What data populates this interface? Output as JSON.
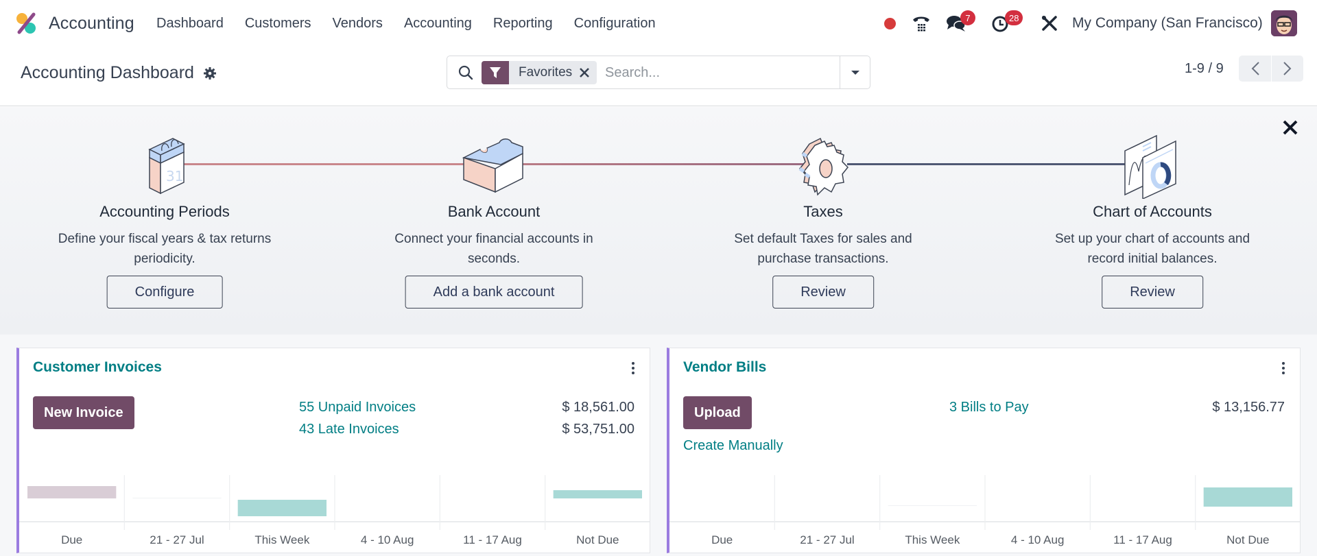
{
  "navbar": {
    "app_name": "Accounting",
    "menu": [
      "Dashboard",
      "Customers",
      "Vendors",
      "Accounting",
      "Reporting",
      "Configuration"
    ],
    "systray": {
      "messages_badge": "7",
      "activities_badge": "28",
      "company": "My Company (San Francisco)"
    }
  },
  "control_panel": {
    "title": "Accounting Dashboard",
    "search": {
      "facet_label": "Favorites",
      "placeholder": "Search...",
      "value": ""
    },
    "pager": "1-9 / 9"
  },
  "onboarding": {
    "steps": [
      {
        "title": "Accounting Periods",
        "description": "Define your fiscal years & tax returns periodicity.",
        "button": "Configure",
        "icon": "calendar-icon"
      },
      {
        "title": "Bank Account",
        "description": "Connect your financial accounts in seconds.",
        "button": "Add a bank account",
        "icon": "puzzle-piece-icon"
      },
      {
        "title": "Taxes",
        "description": "Set default Taxes for sales and purchase transactions.",
        "button": "Review",
        "icon": "cog-icon"
      },
      {
        "title": "Chart of Accounts",
        "description": "Set up your chart of accounts and record initial balances.",
        "button": "Review",
        "icon": "chart-pages-icon"
      }
    ]
  },
  "cards": {
    "customer_invoices": {
      "title": "Customer Invoices",
      "primary_button": "New Invoice",
      "links": [
        {
          "label": "55 Unpaid Invoices",
          "amount": "$ 18,561.00"
        },
        {
          "label": "43 Late Invoices",
          "amount": "$ 53,751.00"
        }
      ]
    },
    "vendor_bills": {
      "title": "Vendor Bills",
      "primary_button": "Upload",
      "secondary_link": "Create Manually",
      "links": [
        {
          "label": "3 Bills to Pay",
          "amount": "$ 13,156.77"
        }
      ]
    }
  },
  "colors": {
    "brand": "#714b67",
    "link": "#017e84",
    "bar_future": "#a8d9d6",
    "bar_past": "#d9cdd6",
    "card_accent": "#9b7ce0"
  },
  "chart_data": [
    {
      "type": "bar",
      "title": "Customer Invoices",
      "categories": [
        "Due",
        "21 - 27 Jul",
        "This Week",
        "4 - 10 Aug",
        "11 - 17 Aug",
        "Not Due"
      ],
      "values": [
        -3,
        -0.05,
        4,
        0,
        0,
        -2
      ],
      "value_note": "unlabeled; relative estimates (baseline-offset bars)",
      "xlabel": "",
      "ylabel": "",
      "ylim": [
        -7.5,
        4.5
      ]
    },
    {
      "type": "bar",
      "title": "Vendor Bills",
      "categories": [
        "Due",
        "21 - 27 Jul",
        "This Week",
        "4 - 10 Aug",
        "11 - 17 Aug",
        "Not Due"
      ],
      "values": [
        0,
        0,
        0.05,
        0,
        0,
        4.5
      ],
      "value_note": "unlabeled; relative estimates",
      "xlabel": "",
      "ylabel": "",
      "ylim": [
        0,
        9
      ]
    }
  ]
}
